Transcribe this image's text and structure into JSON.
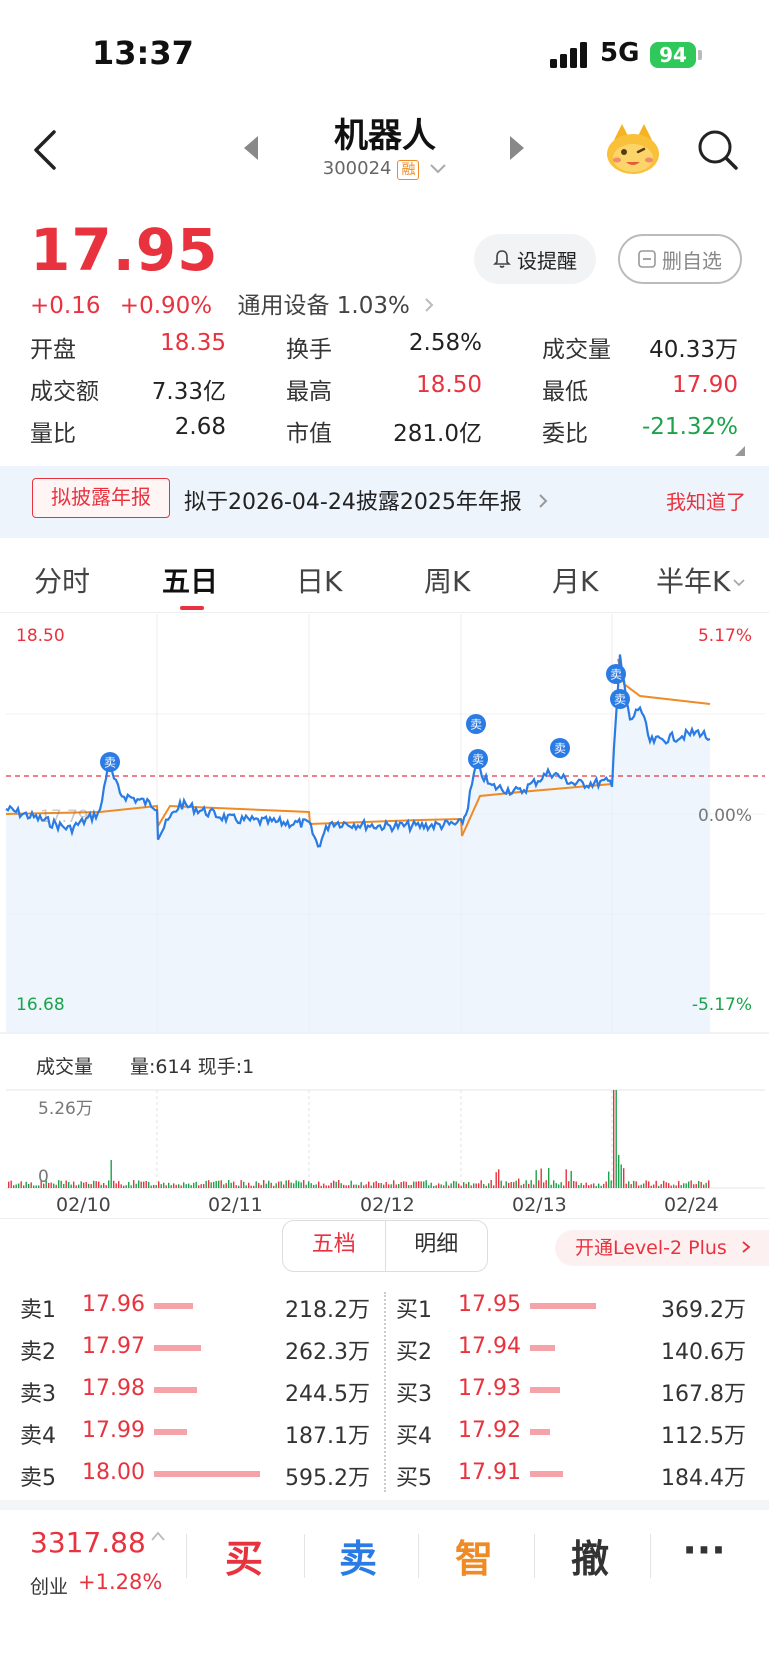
{
  "status_bar": {
    "time": "13:37",
    "network": "5G",
    "battery": "94"
  },
  "header": {
    "name": "机器人",
    "code": "300024",
    "margin_badge": "融"
  },
  "quote": {
    "price": "17.95",
    "change": "+0.16",
    "change_pct": "+0.90%",
    "sector": "通用设备 1.03%",
    "set_alert": "设提醒",
    "remove_watch": "删自选"
  },
  "stats": [
    {
      "label": "开盘",
      "value": "18.35",
      "color": "#e8333f"
    },
    {
      "label": "换手",
      "value": "2.58%",
      "color": "#222222"
    },
    {
      "label": "成交量",
      "value": "40.33万",
      "color": "#222222"
    },
    {
      "label": "成交额",
      "value": "7.33亿",
      "color": "#222222"
    },
    {
      "label": "最高",
      "value": "18.50",
      "color": "#e8333f"
    },
    {
      "label": "最低",
      "value": "17.90",
      "color": "#e8333f"
    },
    {
      "label": "量比",
      "value": "2.68",
      "color": "#222222"
    },
    {
      "label": "市值",
      "value": "281.0亿",
      "color": "#222222"
    },
    {
      "label": "委比",
      "value": "-21.32%",
      "color": "#1aa34a"
    }
  ],
  "notice": {
    "tag": "拟披露年报",
    "text": "拟于2026-04-24披露2025年年报",
    "dismiss": "我知道了"
  },
  "tabs": [
    "分时",
    "五日",
    "日K",
    "周K",
    "月K",
    "半年K"
  ],
  "chart": {
    "y_top": "18.50",
    "y_mid": "17.79",
    "y_bottom": "16.68",
    "pct_top": "5.17%",
    "pct_mid": "0.00%",
    "pct_bottom": "-5.17%",
    "sell_marker": "卖"
  },
  "volume": {
    "title": "成交量",
    "info": "量:614 现手:1",
    "max_label": "5.26万",
    "zero_label": "0",
    "dates": [
      "02/10",
      "02/11",
      "02/12",
      "02/13",
      "02/24"
    ]
  },
  "order_book": {
    "toggle": [
      "五档",
      "明细"
    ],
    "level2": "开通Level-2 Plus",
    "sells": [
      {
        "label": "卖1",
        "price": "17.96",
        "vol": "218.2万",
        "ratio": 0.37
      },
      {
        "label": "卖2",
        "price": "17.97",
        "vol": "262.3万",
        "ratio": 0.44
      },
      {
        "label": "卖3",
        "price": "17.98",
        "vol": "244.5万",
        "ratio": 0.41
      },
      {
        "label": "卖4",
        "price": "17.99",
        "vol": "187.1万",
        "ratio": 0.31
      },
      {
        "label": "卖5",
        "price": "18.00",
        "vol": "595.2万",
        "ratio": 1.0
      }
    ],
    "buys": [
      {
        "label": "买1",
        "price": "17.95",
        "vol": "369.2万",
        "ratio": 0.62
      },
      {
        "label": "买2",
        "price": "17.94",
        "vol": "140.6万",
        "ratio": 0.24
      },
      {
        "label": "买3",
        "price": "17.93",
        "vol": "167.8万",
        "ratio": 0.28
      },
      {
        "label": "买4",
        "price": "17.92",
        "vol": "112.5万",
        "ratio": 0.19
      },
      {
        "label": "买5",
        "price": "17.91",
        "vol": "184.4万",
        "ratio": 0.31
      }
    ]
  },
  "bottom_bar": {
    "index_value": "3317.88",
    "index_name": "创业",
    "index_change": "+1.28%",
    "actions": [
      {
        "label": "买",
        "color": "#e8333f"
      },
      {
        "label": "卖",
        "color": "#2a7be4"
      },
      {
        "label": "智",
        "color": "#f08a24"
      },
      {
        "label": "撤",
        "color": "#333333"
      },
      {
        "label": "···",
        "color": "#333333"
      }
    ]
  },
  "colors": {
    "up": "#e8333f",
    "down": "#1aa34a",
    "price_line": "#2a7be4",
    "avg_line": "#f08a24"
  }
}
